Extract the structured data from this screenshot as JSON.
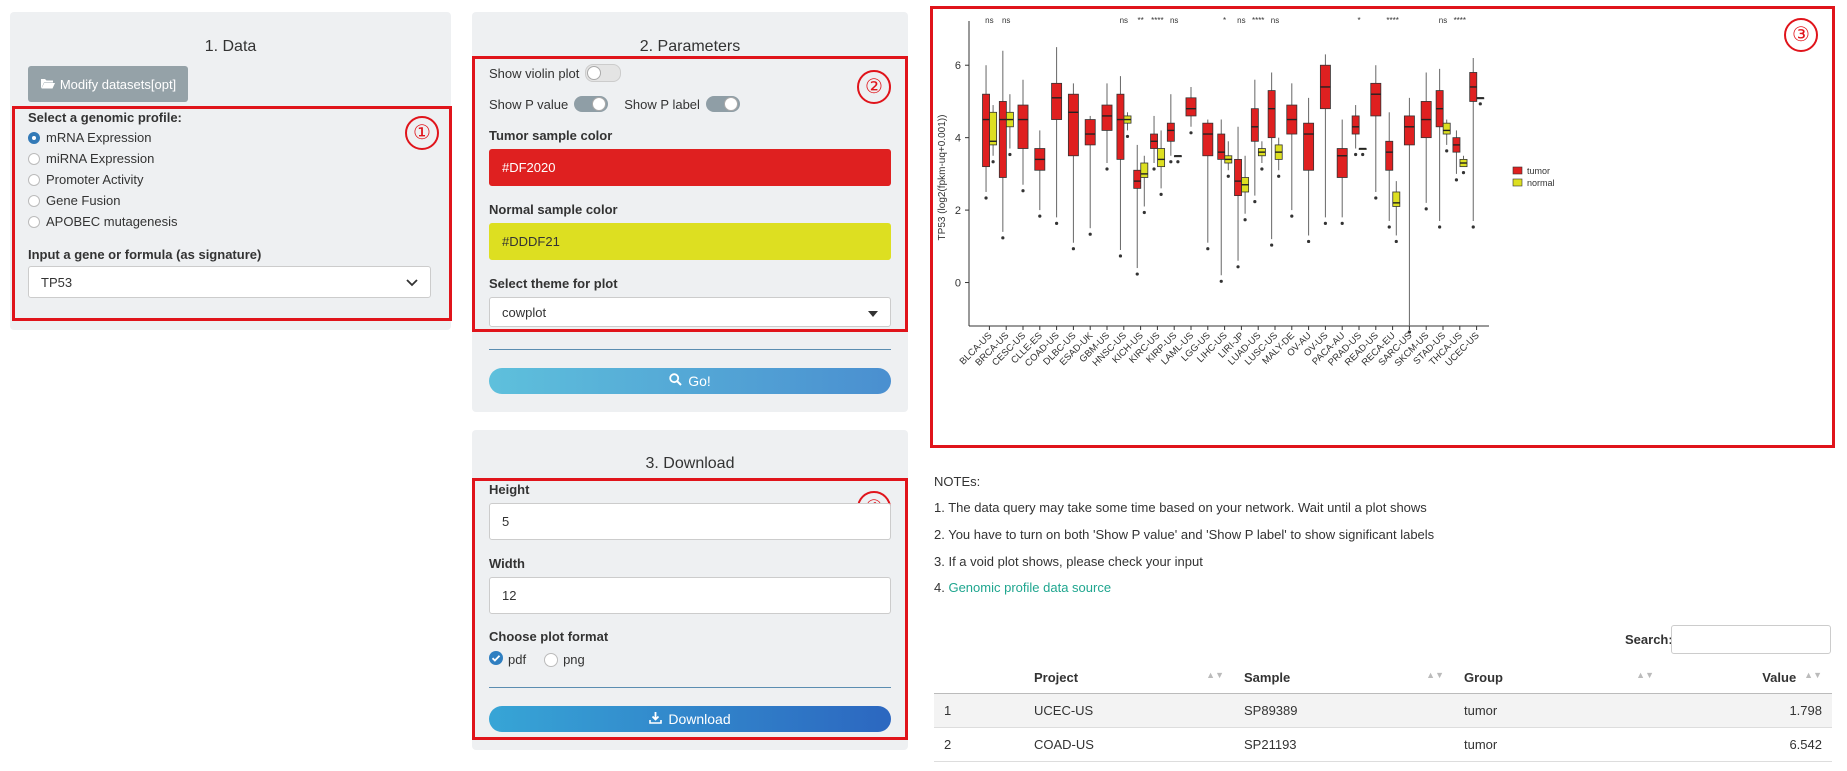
{
  "panel1": {
    "title": "1. Data",
    "modify_button": "Modify datasets[opt]",
    "profile_label": "Select a genomic profile:",
    "profiles": [
      "mRNA Expression",
      "miRNA Expression",
      "Promoter Activity",
      "Gene Fusion",
      "APOBEC mutagenesis"
    ],
    "selected_profile": "mRNA Expression",
    "gene_label": "Input a gene or formula (as signature)",
    "gene_value": "TP53"
  },
  "panel2": {
    "title": "2. Parameters",
    "violin_label": "Show violin plot",
    "violin_on": false,
    "pvalue_label": "Show P value",
    "pvalue_on": true,
    "plabel_label": "Show P label",
    "plabel_on": true,
    "tumor_color_label": "Tumor sample color",
    "tumor_color": "#DF2020",
    "normal_color_label": "Normal sample color",
    "normal_color": "#DDDF21",
    "theme_label": "Select theme for plot",
    "theme_value": "cowplot",
    "go_button": "Go!"
  },
  "panel3": {
    "title": "3. Download",
    "height_label": "Height",
    "height_value": "5",
    "width_label": "Width",
    "width_value": "12",
    "format_label": "Choose plot format",
    "formats": [
      "pdf",
      "png"
    ],
    "format_selected": "pdf",
    "download_button": "Download"
  },
  "annotations": [
    "①",
    "②",
    "③",
    "④"
  ],
  "notes": {
    "heading": "NOTEs:",
    "items": [
      "1. The data query may take some time based on your network. Wait until a plot shows",
      "2. You have to turn on both 'Show P value' and 'Show P label' to show significant labels",
      "3. If a void plot shows, please check your input"
    ],
    "link_prefix": "4. ",
    "link_text": "Genomic profile data source"
  },
  "table": {
    "search_label": "Search:",
    "columns": [
      "",
      "Project",
      "Sample",
      "Group",
      "Value"
    ],
    "rows": [
      [
        "1",
        "UCEC-US",
        "SP89389",
        "tumor",
        "1.798"
      ],
      [
        "2",
        "COAD-US",
        "SP21193",
        "tumor",
        "6.542"
      ]
    ]
  },
  "colors": {
    "tumor": "#DF2020",
    "normal": "#DDDF21",
    "accent_red": "#e0141b",
    "button": "#4aa3d8"
  },
  "chart_data": {
    "type": "box",
    "ylabel": "TP53 (log2(fpkm-uq+0.001))",
    "ylim": [
      -1.2,
      7
    ],
    "yticks": [
      0,
      2,
      4,
      6
    ],
    "legend": [
      "tumor",
      "normal"
    ],
    "legend_position": "right",
    "categories": [
      "BLCA-US",
      "BRCA-US",
      "CESC-US",
      "CLLE-ES",
      "COAD-US",
      "DLBC-US",
      "ESAD-UK",
      "GBM-US",
      "HNSC-US",
      "KICH-US",
      "KIRC-US",
      "KIRP-US",
      "LAML-US",
      "LGG-US",
      "LIHC-US",
      "LIRI-JP",
      "LUAD-US",
      "LUSC-US",
      "MALY-DE",
      "OV-AU",
      "OV-US",
      "PACA-AU",
      "PRAD-US",
      "READ-US",
      "RECA-EU",
      "SARC-US",
      "SKCM-US",
      "STAD-US",
      "THCA-US",
      "UCEC-US"
    ],
    "sig_labels": [
      "ns",
      "ns",
      "",
      "",
      "",
      "",
      "",
      "",
      "ns",
      "**",
      "****",
      "ns",
      "",
      "",
      "*",
      "ns",
      "****",
      "ns",
      "",
      "",
      "",
      "",
      "*",
      "",
      "****",
      "",
      "",
      "ns",
      "****",
      ""
    ],
    "tumor": [
      [
        3.2,
        4.5,
        5.2,
        6.0,
        2.5
      ],
      [
        2.9,
        4.5,
        5.0,
        6.4,
        1.4
      ],
      [
        3.7,
        4.5,
        4.9,
        5.6,
        2.7
      ],
      [
        3.1,
        3.4,
        3.7,
        4.2,
        2.0
      ],
      [
        4.5,
        5.1,
        5.5,
        6.5,
        1.8
      ],
      [
        3.5,
        4.7,
        5.2,
        5.5,
        1.1
      ],
      [
        3.8,
        4.1,
        4.5,
        4.6,
        1.5
      ],
      [
        4.2,
        4.6,
        4.9,
        5.5,
        3.3
      ],
      [
        3.4,
        4.5,
        5.2,
        5.7,
        0.9
      ],
      [
        2.6,
        2.8,
        3.1,
        3.8,
        0.4
      ],
      [
        3.7,
        3.9,
        4.1,
        4.6,
        3.3
      ],
      [
        3.9,
        4.2,
        4.4,
        5.2,
        3.5
      ],
      [
        4.6,
        4.8,
        5.1,
        5.4,
        4.3
      ],
      [
        3.5,
        4.1,
        4.4,
        4.5,
        1.1
      ],
      [
        3.4,
        3.6,
        4.1,
        4.5,
        0.2
      ],
      [
        2.4,
        2.8,
        3.4,
        4.3,
        0.6
      ],
      [
        3.9,
        4.3,
        4.8,
        5.6,
        2.4
      ],
      [
        4.0,
        4.8,
        5.3,
        5.8,
        1.2
      ],
      [
        4.1,
        4.5,
        4.9,
        5.5,
        2.0
      ],
      [
        3.1,
        4.1,
        4.4,
        5.1,
        1.3
      ],
      [
        4.8,
        5.4,
        6.0,
        6.3,
        1.8
      ],
      [
        2.9,
        3.5,
        3.7,
        4.5,
        1.8
      ],
      [
        4.1,
        4.3,
        4.6,
        4.9,
        3.7
      ],
      [
        4.6,
        5.2,
        5.5,
        6.0,
        2.5
      ],
      [
        3.1,
        3.6,
        3.9,
        4.7,
        1.7
      ],
      [
        3.8,
        4.3,
        4.6,
        5.1,
        -1.2
      ],
      [
        4.0,
        4.5,
        5.0,
        5.8,
        2.2
      ],
      [
        4.3,
        4.8,
        5.3,
        5.9,
        1.7
      ],
      [
        3.6,
        3.8,
        4.0,
        4.2,
        3.0
      ],
      [
        5.0,
        5.4,
        5.8,
        6.2,
        1.7
      ]
    ],
    "normal": {
      "BLCA-US": [
        3.8,
        3.9,
        4.7,
        4.9,
        3.5
      ],
      "BRCA-US": [
        4.3,
        4.5,
        4.7,
        5.2,
        3.7
      ],
      "HNSC-US": [
        4.4,
        4.5,
        4.6,
        4.7,
        4.2
      ],
      "KICH-US": [
        2.9,
        3.0,
        3.3,
        3.5,
        2.1
      ],
      "KIRC-US": [
        3.2,
        3.4,
        3.7,
        4.2,
        2.6
      ],
      "KIRP-US": [
        3.5,
        3.5,
        3.5,
        3.5,
        3.5
      ],
      "LIHC-US": [
        3.3,
        3.4,
        3.5,
        3.9,
        3.1
      ],
      "LIRI-JP": [
        2.5,
        2.7,
        2.9,
        3.5,
        1.9
      ],
      "LUAD-US": [
        3.5,
        3.6,
        3.7,
        3.9,
        3.3
      ],
      "LUSC-US": [
        3.4,
        3.6,
        3.8,
        4.0,
        3.1
      ],
      "PRAD-US": [
        3.7,
        3.7,
        3.7,
        3.7,
        3.7
      ],
      "RECA-EU": [
        2.1,
        2.2,
        2.5,
        2.8,
        1.3
      ],
      "STAD-US": [
        4.1,
        4.2,
        4.4,
        4.5,
        3.8
      ],
      "THCA-US": [
        3.2,
        3.3,
        3.4,
        3.5,
        3.2
      ],
      "UCEC-US": [
        5.1,
        5.1,
        5.1,
        5.1,
        5.1
      ]
    }
  }
}
